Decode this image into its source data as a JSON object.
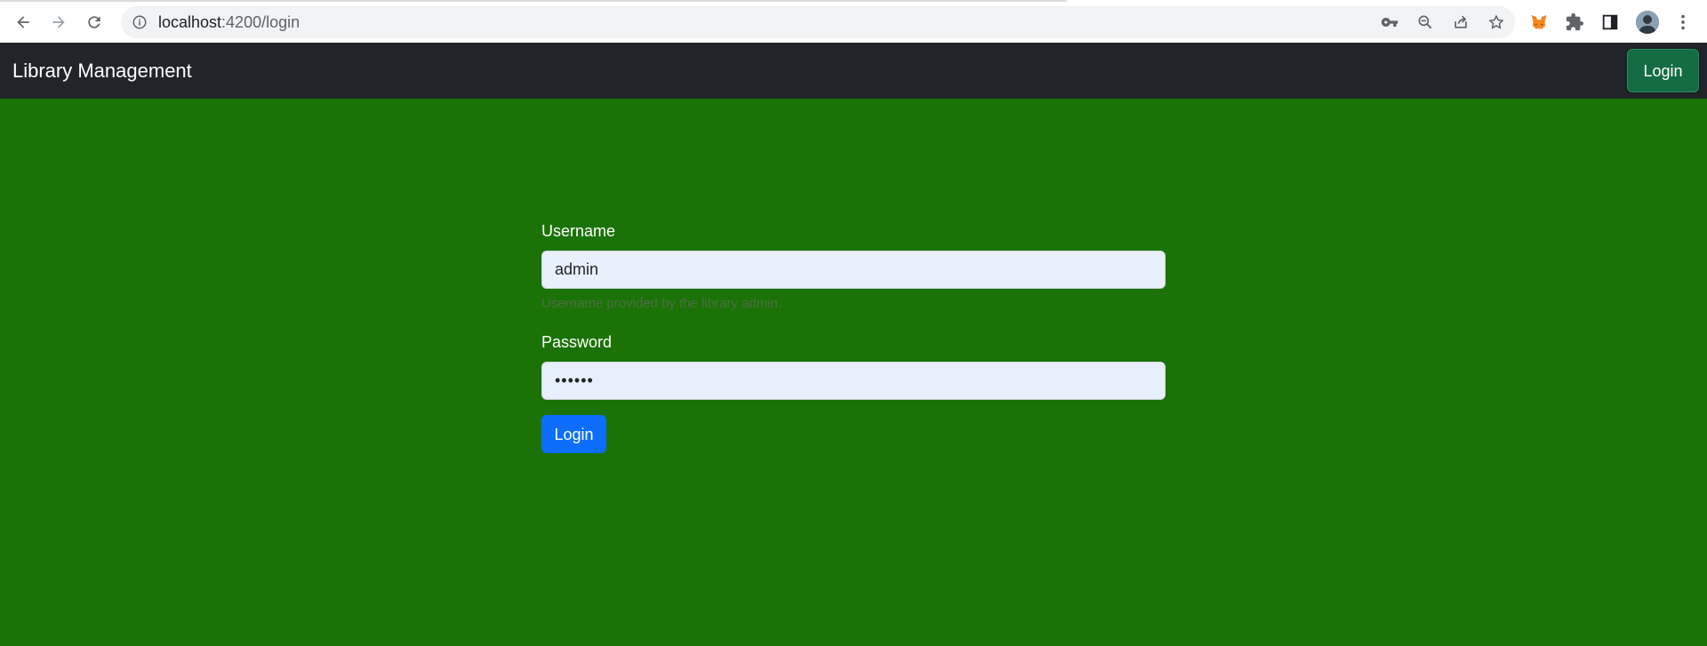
{
  "browser": {
    "url_host": "localhost",
    "url_path": ":4200/login",
    "icons": {
      "back": "back-arrow-icon",
      "forward": "forward-arrow-icon",
      "reload": "reload-icon",
      "site_info": "info-icon",
      "password_key": "key-icon",
      "zoom": "zoom-out-icon",
      "share": "share-icon",
      "bookmark": "star-icon",
      "metamask": "fox-extension-icon",
      "extensions": "puzzle-icon",
      "side_panel": "side-panel-icon",
      "profile": "avatar",
      "menu": "kebab-menu-icon"
    }
  },
  "navbar": {
    "brand": "Library Management",
    "login_button": "Login",
    "background": "#212529",
    "button_color": "#146c43"
  },
  "form": {
    "username_label": "Username",
    "username_value": "admin",
    "username_help": "Username provided by the library admin.",
    "password_label": "Password",
    "password_value": "••••••",
    "submit_label": "Login",
    "input_background": "#e8f0fe",
    "submit_color": "#0d6efd"
  },
  "page": {
    "background": "#1b7307"
  }
}
